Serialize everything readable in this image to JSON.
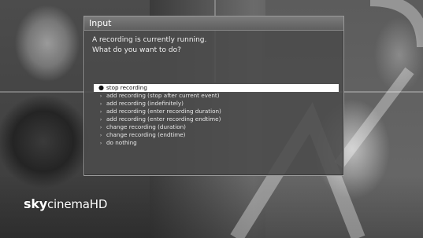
{
  "dialog": {
    "title": "Input",
    "message_line1": "A recording is currently running.",
    "message_line2": "What do you want to do?",
    "options": [
      {
        "label": "stop recording",
        "selected": true
      },
      {
        "label": "add recording (stop after current event)",
        "selected": false
      },
      {
        "label": "add recording (indefinitely)",
        "selected": false
      },
      {
        "label": "add recording (enter recording duration)",
        "selected": false
      },
      {
        "label": "add recording (enter recording endtime)",
        "selected": false
      },
      {
        "label": "change recording (duration)",
        "selected": false
      },
      {
        "label": "change recording (endtime)",
        "selected": false
      },
      {
        "label": "do nothing",
        "selected": false
      }
    ]
  },
  "channel_logo": {
    "part1": "sky",
    "part2": "cinema",
    "part3": "HD"
  },
  "colors": {
    "selected_row_bg": "#ffffff",
    "dialog_bg": "#4b4b4b",
    "text": "#f0f0f0"
  },
  "icons": {
    "selected_option": "radio-filled-icon",
    "option_bullet": "chevron-right-icon"
  }
}
